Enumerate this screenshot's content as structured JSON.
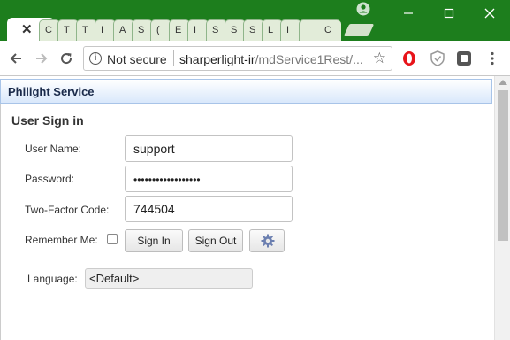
{
  "browser": {
    "tabs": [
      "C",
      "T",
      "T",
      "I",
      "A",
      "S",
      "(",
      "E",
      "I",
      "S",
      "S",
      "S",
      "L",
      "I",
      "C"
    ],
    "address": {
      "security_label": "Not secure",
      "host": "sharperlight-ir",
      "path": "/mdService1Rest/..."
    },
    "colors": {
      "frame": "#1d7e1d"
    }
  },
  "app": {
    "header_title": "Philight Service",
    "signin": {
      "title": "User Sign in",
      "username_label": "User Name:",
      "username_value": "support",
      "password_label": "Password:",
      "password_value": "••••••••••••••••••",
      "twofactor_label": "Two-Factor Code:",
      "twofactor_value": "744504",
      "remember_label": "Remember Me:",
      "remember_checked": false,
      "signin_button": "Sign In",
      "signout_button": "Sign Out",
      "settings_icon": "gear-icon",
      "language_label": "Language:",
      "language_value": "<Default>"
    }
  }
}
